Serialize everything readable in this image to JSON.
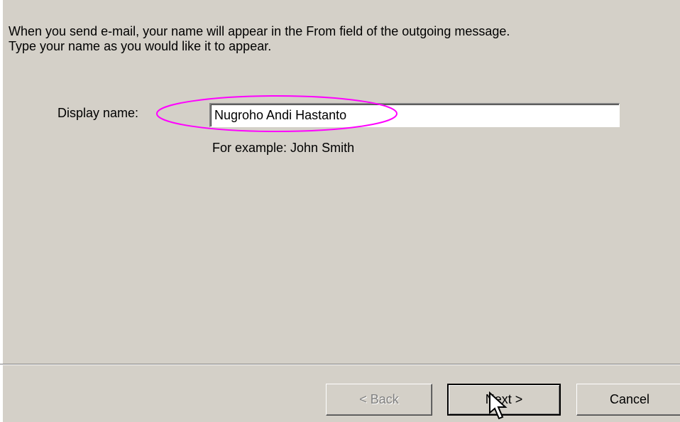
{
  "intro": {
    "line1": "When you send e-mail, your name will appear in the From field of the outgoing message.",
    "line2": "Type your name as you would like it to appear."
  },
  "display_name": {
    "label": "Display name:",
    "value": "Nugroho Andi Hastanto",
    "example": "For example: John Smith"
  },
  "buttons": {
    "back": "< Back",
    "next": "Next >",
    "cancel": "Cancel"
  },
  "colors": {
    "background": "#d4d0c8",
    "highlight": "#ff00ff"
  }
}
